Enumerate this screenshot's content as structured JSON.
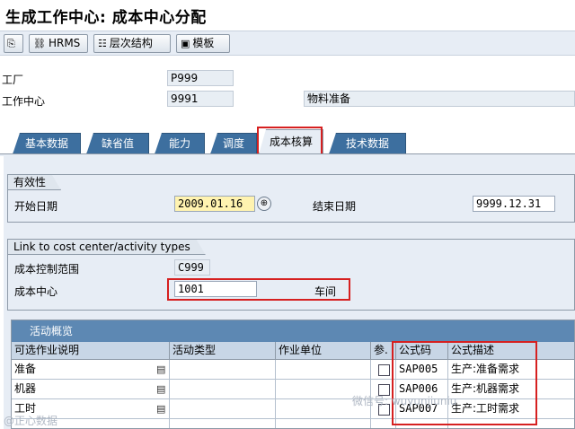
{
  "title": "生成工作中心: 成本中心分配",
  "toolbar": {
    "hrms": "HRMS",
    "hierarchy": "层次结构",
    "template": "模板"
  },
  "header": {
    "plant_label": "工厂",
    "plant_value": "P999",
    "workcenter_label": "工作中心",
    "workcenter_value": "9991",
    "workcenter_desc": "物料准备"
  },
  "tabs": [
    "基本数据",
    "缺省值",
    "能力",
    "调度",
    "成本核算",
    "技术数据"
  ],
  "validity": {
    "group_title": "有效性",
    "start_label": "开始日期",
    "start_value": "2009.01.16",
    "end_label": "结束日期",
    "end_value": "9999.12.31"
  },
  "link": {
    "group_title": "Link to cost center/activity types",
    "controlling_area_label": "成本控制范围",
    "controlling_area_value": "C999",
    "cost_center_label": "成本中心",
    "cost_center_value": "1001",
    "cost_center_desc": "车间"
  },
  "activity_table": {
    "title": "活动概览",
    "columns": [
      "可选作业说明",
      "活动类型",
      "作业单位",
      "参.",
      "公式码",
      "公式描述"
    ],
    "rows": [
      {
        "desc": "准备",
        "activity_type": "",
        "unit": "",
        "formula_code": "SAP005",
        "formula_desc": "生产:准备需求"
      },
      {
        "desc": "机器",
        "activity_type": "",
        "unit": "",
        "formula_code": "SAP006",
        "formula_desc": "生产:机器需求"
      },
      {
        "desc": "工时",
        "activity_type": "",
        "unit": "",
        "formula_code": "SAP007",
        "formula_desc": "生产:工时需求"
      }
    ]
  },
  "watermark": {
    "right": "微信号: wuyunjiuniu",
    "left": "@正心数据"
  },
  "colors": {
    "tab": "#3d6f9f",
    "highlight_box": "#d62020",
    "table_title": "#5d88b3"
  }
}
